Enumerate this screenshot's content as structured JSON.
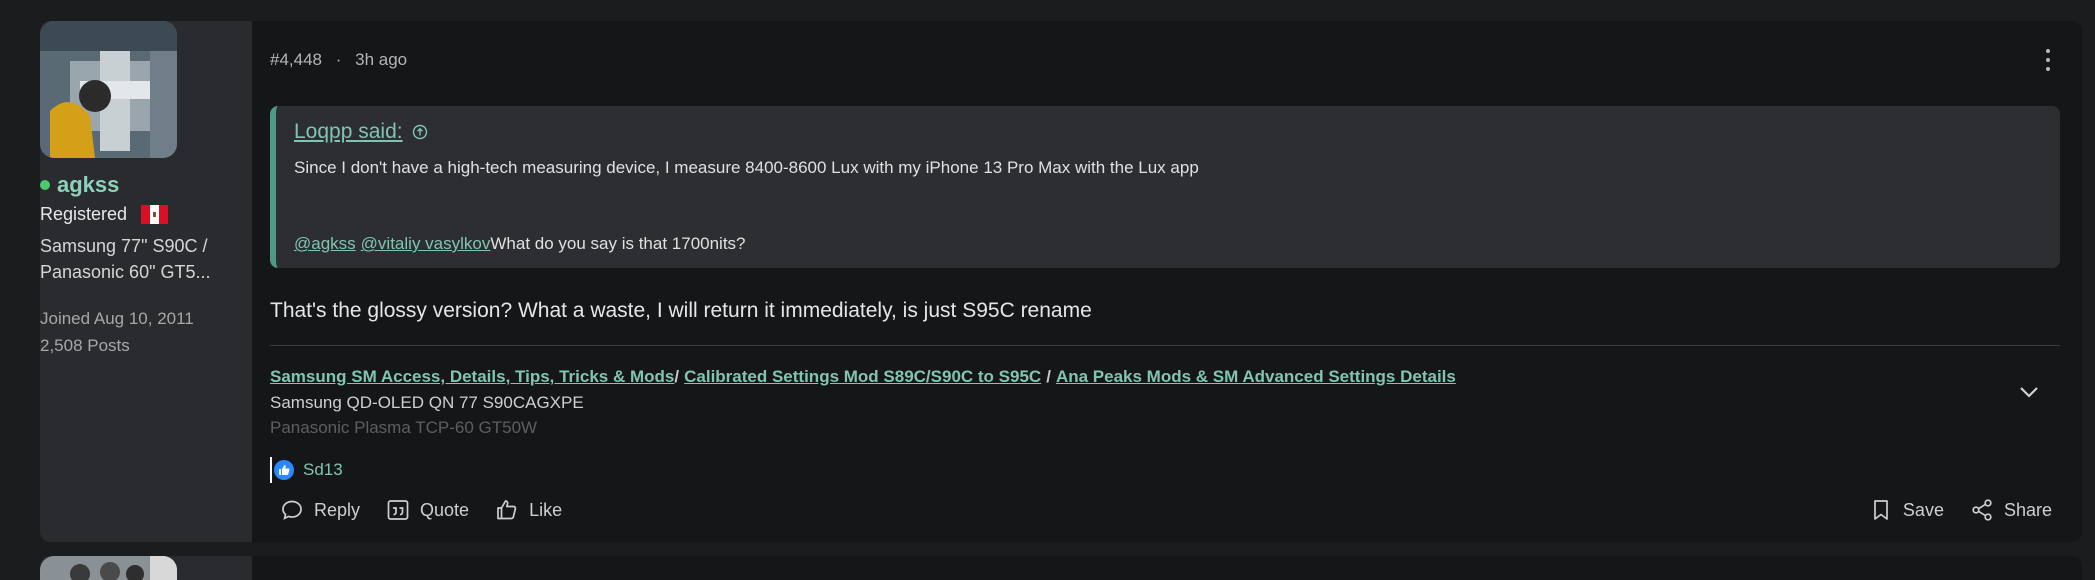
{
  "user": {
    "name": "agkss",
    "title": "Registered",
    "signature_lines": [
      "Samsung 77\" S90C /",
      "Panasonic 60\" GT5..."
    ],
    "joined": "Joined Aug 10, 2011",
    "posts": "2,508 Posts",
    "online_color": "#4cc96b",
    "name_color": "#8cd3b8"
  },
  "post": {
    "number": "#4,448",
    "separator": "·",
    "time": "3h ago",
    "quote": {
      "author": "Loqpp said:",
      "line1": "Since I don't have a high-tech measuring device, I measure 8400-8600 Lux with my iPhone 13 Pro Max with the Lux app",
      "mention1": "@agkss",
      "mention2": "@vitaliy vasylkov",
      "line2_text": "What do you say is that 1700nits?"
    },
    "body": "That's the glossy version? What a waste, I will return it immediately, is just S95C rename",
    "signature": {
      "links": [
        "Samsung SM Access, Details, Tips, Tricks & Mods",
        "Calibrated Settings Mod S89C/S90C to S95C",
        "Ana Peaks Mods & SM Advanced Settings Details"
      ],
      "sep1": "/",
      "sep2": "/",
      "line2": "Samsung QD-OLED QN 77 S90CAGXPE",
      "line3": "Panasonic Plasma TCP-60 GT50W"
    },
    "reactions": {
      "icon": "like-icon",
      "users": "Sd13"
    },
    "actions": {
      "reply": "Reply",
      "quote": "Quote",
      "like": "Like",
      "save": "Save",
      "share": "Share"
    }
  },
  "colors": {
    "accent": "#7fc5b1",
    "quote_border": "#4e9a84",
    "like_blue": "#2d88ff"
  }
}
